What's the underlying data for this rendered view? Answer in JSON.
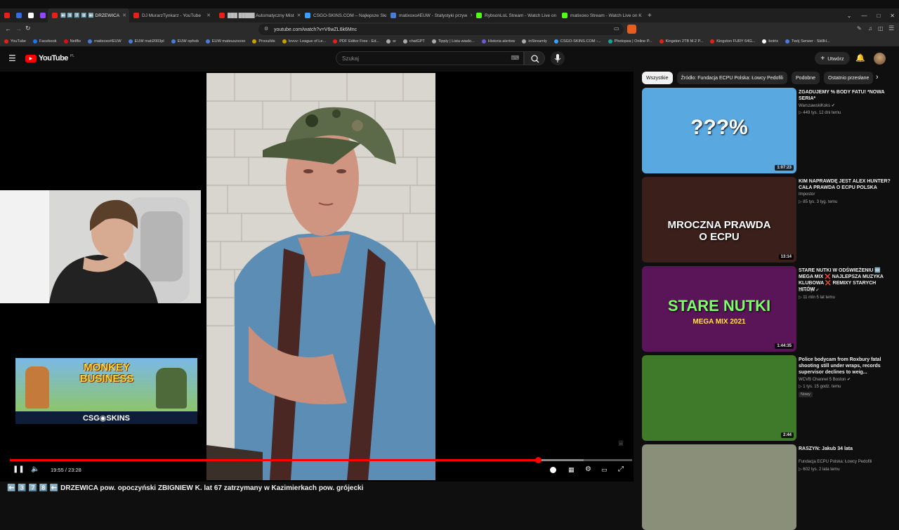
{
  "browser": {
    "tabs": [
      {
        "label": "",
        "color": "#e62117"
      },
      {
        "label": "",
        "color": "#2f6fe0"
      },
      {
        "label": "",
        "color": "#ffffff"
      },
      {
        "label": "",
        "color": "#9146ff"
      },
      {
        "label": "⬅️ 3️⃣ 7️⃣ 8️⃣ ⬅️ DRZEWICA",
        "color": "#e62117",
        "active": true
      },
      {
        "label": "DJ MurarzTynkarz - YouTube",
        "color": "#e62117"
      },
      {
        "label": "███ █████ Automatyczny Mist",
        "color": "#e62117"
      },
      {
        "label": "CSGO-SKINS.COM – Najlepsze Skrzy",
        "color": "#3aa0ff"
      },
      {
        "label": "matixoxo#EUW - Statystyki przyw",
        "color": "#4a7bd8"
      },
      {
        "label": "RybsonLoL Stream - Watch Live on K",
        "color": "#53fc18"
      },
      {
        "label": "matixoxo Stream - Watch Live on K",
        "color": "#53fc18"
      }
    ],
    "new_tab": "+",
    "url": "youtube.com/watch?v=V6wZL6k6Mnc",
    "bookmarks": [
      {
        "label": "YouTube",
        "color": "#e62117"
      },
      {
        "label": "Facebook",
        "color": "#1877f2"
      },
      {
        "label": "Netflix",
        "color": "#e50914"
      },
      {
        "label": "matixoxo#EUW",
        "color": "#4a7bd8"
      },
      {
        "label": "EUW mati2003pl",
        "color": "#4a7bd8"
      },
      {
        "label": "EUW ophob",
        "color": "#4a7bd8"
      },
      {
        "label": "EUW mateuszxoxo",
        "color": "#4a7bd8"
      },
      {
        "label": "Proouilds",
        "color": "#c8a000"
      },
      {
        "label": "Iovvv: League of Le...",
        "color": "#c8a000"
      },
      {
        "label": "PDF Editor Free - Ed...",
        "color": "#e62117"
      },
      {
        "label": "sr",
        "color": "#aaaaaa"
      },
      {
        "label": "chatGPT",
        "color": "#aaaaaa"
      },
      {
        "label": "Tipply | Lista wiado...",
        "color": "#aaaaaa"
      },
      {
        "label": "Historia alertow",
        "color": "#6b5bd0"
      },
      {
        "label": "inStreamly",
        "color": "#aaaaaa"
      },
      {
        "label": "CSGO-SKINS.COM -...",
        "color": "#3aa0ff"
      },
      {
        "label": "Photopea | Online P...",
        "color": "#18a497"
      },
      {
        "label": "Kingston 2TB M.2 P...",
        "color": "#e62117"
      },
      {
        "label": "Kingston FURY 64G...",
        "color": "#e62117"
      },
      {
        "label": "botrix",
        "color": "#ffffff"
      },
      {
        "label": "Twój Serwer - SkillH...",
        "color": "#4a7bd8"
      }
    ]
  },
  "youtube": {
    "logo": "YouTube",
    "logo_region": "PL",
    "search_placeholder": "Szukaj",
    "create_label": "Utwórz"
  },
  "player": {
    "time_current": "19:55",
    "time_total": "23:28",
    "progress_fraction": 0.849,
    "banner_title": "MONKEY BUSINESS",
    "banner_brand": "CSG◉SKINS",
    "title": "⬅️ 3️⃣ 7️⃣ 8️⃣ ⬅️ DRZEWICA pow. opoczyński ZBIGNIEW K. lat 67 zatrzymany w Kazimierkach pow. grójecki"
  },
  "chips": [
    "Wszystkie",
    "Źródło: Fundacja ECPU Polska: Łowcy Pedofili",
    "Podobne",
    "Ostatnio przesłane"
  ],
  "recommendations": [
    {
      "title": "ZGADUJEMY % BODY FATU! *NOWA SERIA*",
      "channel": "WarszawskiKoks",
      "verified": true,
      "meta": "449 tys.  12 dni temu",
      "duration": "1:07:23",
      "thumb_text": "???%",
      "thumb_color": "#5aa8e0"
    },
    {
      "title": "KIM NAPRAWDĘ JEST ALEX HUNTER? CAŁA PRAWDA O ECPU POLSKA",
      "channel": "Impostor",
      "verified": false,
      "meta": "85 tys.  3 tyg. temu",
      "duration": "13:14",
      "thumb_text": "MROCZNA PRAWDA O ECPU",
      "thumb_color": "#3a1f1a"
    },
    {
      "title": "STARE NUTKI W ODŚWIEŻENIU 🆕 MEGA MIX ❌ NAJLEPSZA MUZYKA KLUBOWA ❌ REMIXY STARYCH HITÓW",
      "channel": "DJ Wójo",
      "verified": true,
      "meta": "11 mln  5 lat temu",
      "duration": "1:44:35",
      "thumb_text": "STARE NUTKI",
      "thumb_sub": "MEGA MIX 2021",
      "thumb_color": "#5a1458"
    },
    {
      "title": "Police bodycam from Roxbury fatal shooting still under wraps, records supervisor declines to weig...",
      "channel": "WCVB Channel 5 Boston",
      "verified": true,
      "meta": "1 tys.  15 godz. temu",
      "badge": "Nowy",
      "duration": "2:44",
      "thumb_color": "#3f7a2a"
    },
    {
      "title": "RASZYN: Jakub 34 lata",
      "channel": "Fundacja ECPU Polska: Łowcy Pedofili",
      "verified": false,
      "meta": "602 tys.  2 lata temu",
      "duration": "",
      "thumb_color": "#8a8f7a"
    }
  ]
}
